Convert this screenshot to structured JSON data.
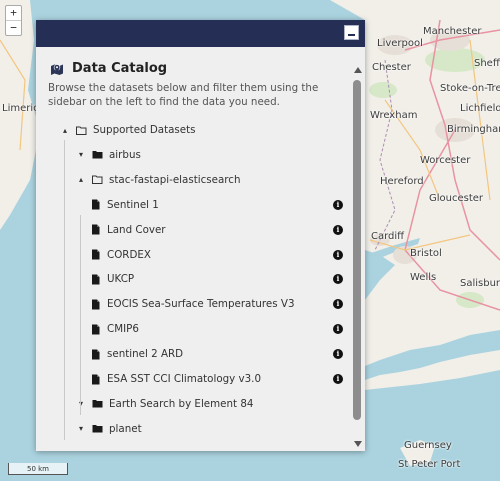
{
  "map": {
    "zoom_in": "+",
    "zoom_out": "−",
    "scale_label": "50 km",
    "places": [
      {
        "label": "Liverpool",
        "big": true
      },
      {
        "label": "Manchester",
        "big": true
      },
      {
        "label": "Sheffield",
        "big": false
      },
      {
        "label": "Stoke-on-Trent",
        "big": false
      },
      {
        "label": "Lichfield",
        "big": false
      },
      {
        "label": "Birmingham",
        "big": true
      },
      {
        "label": "Worcester",
        "big": false
      },
      {
        "label": "Hereford",
        "big": false
      },
      {
        "label": "Gloucester",
        "big": false
      },
      {
        "label": "Cardiff",
        "big": true
      },
      {
        "label": "Bristol",
        "big": true
      },
      {
        "label": "Wells",
        "big": false
      },
      {
        "label": "Salisbury",
        "big": false
      },
      {
        "label": "Limerick",
        "big": false
      },
      {
        "label": "Guernsey",
        "big": true
      },
      {
        "label": "St Peter Port",
        "big": false
      },
      {
        "label": "Wrexham",
        "big": false
      },
      {
        "label": "Chester",
        "big": false
      }
    ]
  },
  "panel": {
    "title": "Data Catalog",
    "description": "Browse the datasets below and filter them using the sidebar on the left to find the data you need.",
    "tree": [
      {
        "label": "Supported Datasets",
        "icon": "folder-open-icon",
        "chevron": "▴",
        "info": false
      },
      {
        "label": "airbus",
        "icon": "folder-icon",
        "chevron": "▾",
        "info": false
      },
      {
        "label": "stac-fastapi-elasticsearch",
        "icon": "folder-open-icon",
        "chevron": "▴",
        "info": false
      },
      {
        "label": "Sentinel 1",
        "icon": "file-icon",
        "chevron": "",
        "info": true
      },
      {
        "label": "Land Cover",
        "icon": "file-icon",
        "chevron": "",
        "info": true
      },
      {
        "label": "CORDEX",
        "icon": "file-icon",
        "chevron": "",
        "info": true
      },
      {
        "label": "UKCP",
        "icon": "file-icon",
        "chevron": "",
        "info": true
      },
      {
        "label": "EOCIS Sea-Surface Temperatures V3",
        "icon": "file-icon",
        "chevron": "",
        "info": true
      },
      {
        "label": "CMIP6",
        "icon": "file-icon",
        "chevron": "",
        "info": true
      },
      {
        "label": "sentinel 2 ARD",
        "icon": "file-icon",
        "chevron": "",
        "info": true
      },
      {
        "label": "ESA SST CCI Climatology v3.0",
        "icon": "file-icon",
        "chevron": "",
        "info": true
      },
      {
        "label": "Earth Search by Element 84",
        "icon": "folder-icon",
        "chevron": "▾",
        "info": false
      },
      {
        "label": "planet",
        "icon": "folder-icon",
        "chevron": "▾",
        "info": false
      }
    ],
    "info_glyph": "i"
  },
  "colors": {
    "header": "#252f55",
    "panel_bg": "#efefef",
    "sea": "#aad3df",
    "land": "#f2efe9"
  }
}
